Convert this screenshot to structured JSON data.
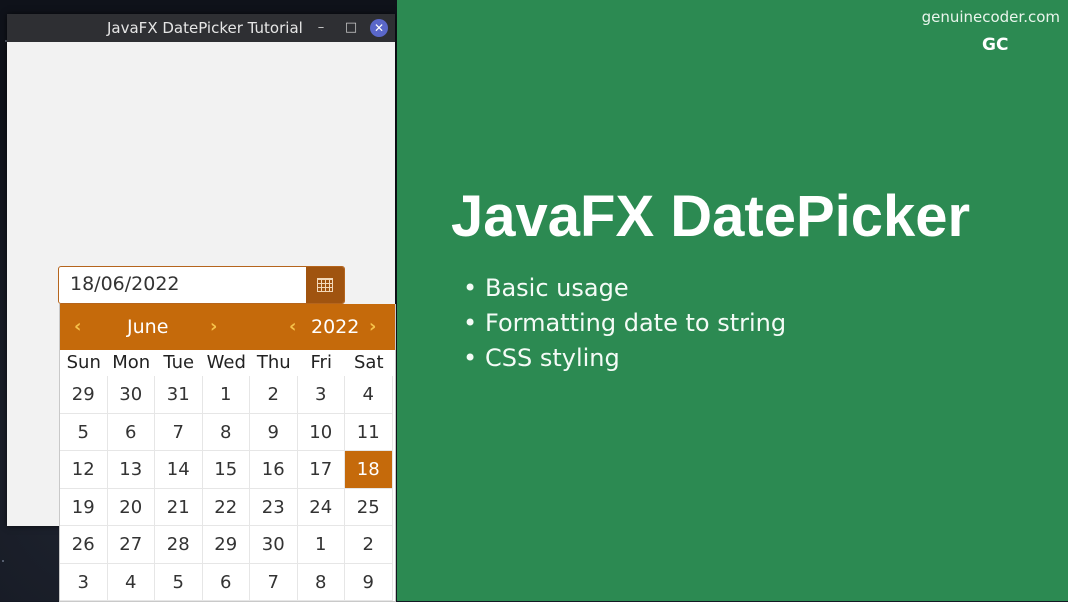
{
  "window": {
    "title": "JavaFX DatePicker Tutorial",
    "min": "–",
    "max": "□",
    "close": "✕"
  },
  "datepicker": {
    "value": "18/06/2022",
    "month": "June",
    "year": "2022",
    "prev_symbol": "‹",
    "next_symbol": "›",
    "weekdays": [
      "Sun",
      "Mon",
      "Tue",
      "Wed",
      "Thu",
      "Fri",
      "Sat"
    ],
    "weeks": [
      [
        "29",
        "30",
        "31",
        "1",
        "2",
        "3",
        "4"
      ],
      [
        "5",
        "6",
        "7",
        "8",
        "9",
        "10",
        "11"
      ],
      [
        "12",
        "13",
        "14",
        "15",
        "16",
        "17",
        "18"
      ],
      [
        "19",
        "20",
        "21",
        "22",
        "23",
        "24",
        "25"
      ],
      [
        "26",
        "27",
        "28",
        "29",
        "30",
        "1",
        "2"
      ],
      [
        "3",
        "4",
        "5",
        "6",
        "7",
        "8",
        "9"
      ]
    ],
    "selected_day": "18"
  },
  "promo": {
    "site": "genuinecoder.com",
    "logo": "GC",
    "headline": "JavaFX DatePicker",
    "bullets": [
      "Basic usage",
      "Formatting date to string",
      "CSS styling"
    ]
  },
  "colors": {
    "accent": "#c56a0b",
    "panel": "#2c8a52",
    "nav_arrows": "#f6c24a"
  }
}
